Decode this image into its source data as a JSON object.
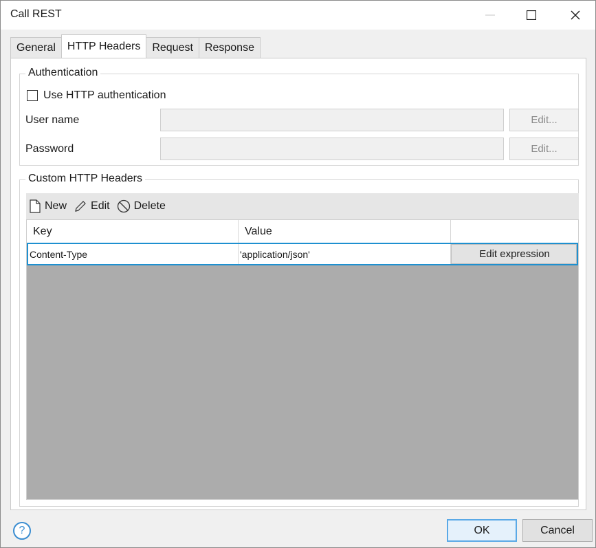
{
  "window": {
    "title": "Call REST"
  },
  "tabs": [
    {
      "label": "General",
      "active": false
    },
    {
      "label": "HTTP Headers",
      "active": true
    },
    {
      "label": "Request",
      "active": false
    },
    {
      "label": "Response",
      "active": false
    }
  ],
  "authentication": {
    "legend": "Authentication",
    "use_http_auth_label": "Use HTTP authentication",
    "use_http_auth_checked": false,
    "username_label": "User name",
    "username_value": "",
    "username_edit_label": "Edit...",
    "password_label": "Password",
    "password_value": "",
    "password_edit_label": "Edit..."
  },
  "custom_headers": {
    "legend": "Custom HTTP Headers",
    "toolbar": {
      "new_label": "New",
      "edit_label": "Edit",
      "delete_label": "Delete"
    },
    "columns": [
      "Key",
      "Value",
      ""
    ],
    "rows": [
      {
        "key": "Content-Type",
        "value": "'application/json'",
        "action_label": "Edit expression"
      }
    ]
  },
  "footer": {
    "ok_label": "OK",
    "cancel_label": "Cancel",
    "help_glyph": "?"
  },
  "colors": {
    "selection_border": "#1e90d0",
    "ok_border": "#5aa9e6",
    "grid_background": "#acacac"
  }
}
